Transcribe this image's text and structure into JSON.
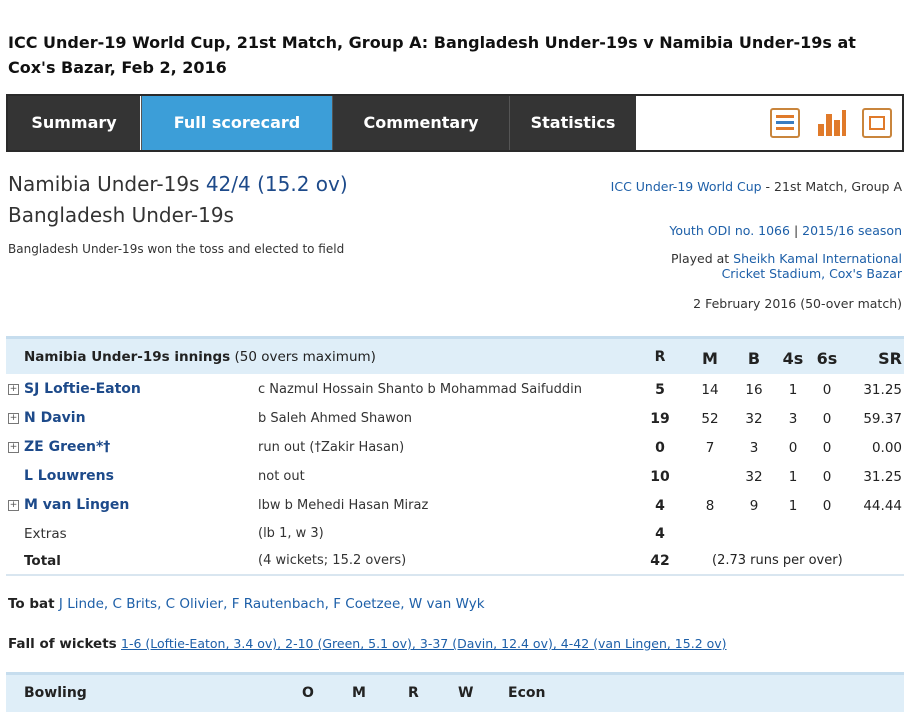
{
  "page_title": "ICC Under-19 World Cup, 21st Match, Group A: Bangladesh Under-19s v Namibia Under-19s at Cox's Bazar, Feb 2, 2016",
  "tabs": [
    {
      "label": "Summary"
    },
    {
      "label": "Full scorecard"
    },
    {
      "label": "Commentary"
    },
    {
      "label": "Statistics"
    }
  ],
  "nav_icons": [
    "scorecard-list-icon",
    "bar-chart-icon",
    "popup-window-icon"
  ],
  "match": {
    "team1_name": "Namibia Under-19s",
    "team1_score": "42/4 (15.2 ov)",
    "team2_name": "Bangladesh Under-19s",
    "toss": "Bangladesh Under-19s won the toss and elected to field",
    "series_link": "ICC Under-19 World Cup",
    "series_rest": " - 21st Match, Group A",
    "odi_link": "Youth ODI no. 1066",
    "separator": " | ",
    "season_link": "2015/16 season",
    "played_at_label": "Played at ",
    "venue_link": "Sheikh Kamal International Cricket Stadium, Cox's Bazar",
    "date": "2 February 2016 (50-over match)"
  },
  "innings": {
    "title": "Namibia Under-19s innings",
    "subtitle": "(50 overs maximum)",
    "headers": {
      "R": "R",
      "M": "M",
      "B": "B",
      "fours": "4s",
      "sixes": "6s",
      "SR": "SR"
    },
    "batsmen": [
      {
        "name": "SJ Loftie-Eaton",
        "expand": "+",
        "dismissal": "c Nazmul Hossain Shanto b Mohammad Saifuddin",
        "R": "5",
        "M": "14",
        "B": "16",
        "fours": "1",
        "sixes": "0",
        "SR": "31.25"
      },
      {
        "name": "N Davin",
        "expand": "+",
        "dismissal": "b Saleh Ahmed Shawon",
        "R": "19",
        "M": "52",
        "B": "32",
        "fours": "3",
        "sixes": "0",
        "SR": "59.37"
      },
      {
        "name": "ZE Green*†",
        "expand": "+",
        "dismissal": "run out (†Zakir Hasan)",
        "R": "0",
        "M": "7",
        "B": "3",
        "fours": "0",
        "sixes": "0",
        "SR": "0.00"
      },
      {
        "name": "L Louwrens",
        "expand": "",
        "dismissal": "not out",
        "R": "10",
        "M": "",
        "B": "32",
        "fours": "1",
        "sixes": "0",
        "SR": "31.25"
      },
      {
        "name": "M van Lingen",
        "expand": "+",
        "dismissal": "lbw b Mehedi Hasan Miraz",
        "R": "4",
        "M": "8",
        "B": "9",
        "fours": "1",
        "sixes": "0",
        "SR": "44.44"
      }
    ],
    "extras_label": "Extras",
    "extras_detail": "(lb 1, w 3)",
    "extras_value": "4",
    "total_label": "Total",
    "total_detail": "(4 wickets; 15.2 overs)",
    "total_value": "42",
    "run_rate": "(2.73 runs per over)"
  },
  "to_bat": {
    "label": "To bat",
    "players": "J Linde, C Brits, C Olivier, F Rautenbach, F Coetzee, W van Wyk"
  },
  "fall_of_wickets": {
    "label": "Fall of wickets",
    "text": "1-6 (Loftie-Eaton, 3.4 ov), 2-10 (Green, 5.1 ov), 3-37 (Davin, 12.4 ov), 4-42 (van Lingen, 15.2 ov)"
  },
  "bowling": {
    "title": "Bowling",
    "headers": {
      "O": "O",
      "M": "M",
      "R": "R",
      "W": "W",
      "Econ": "Econ"
    }
  }
}
